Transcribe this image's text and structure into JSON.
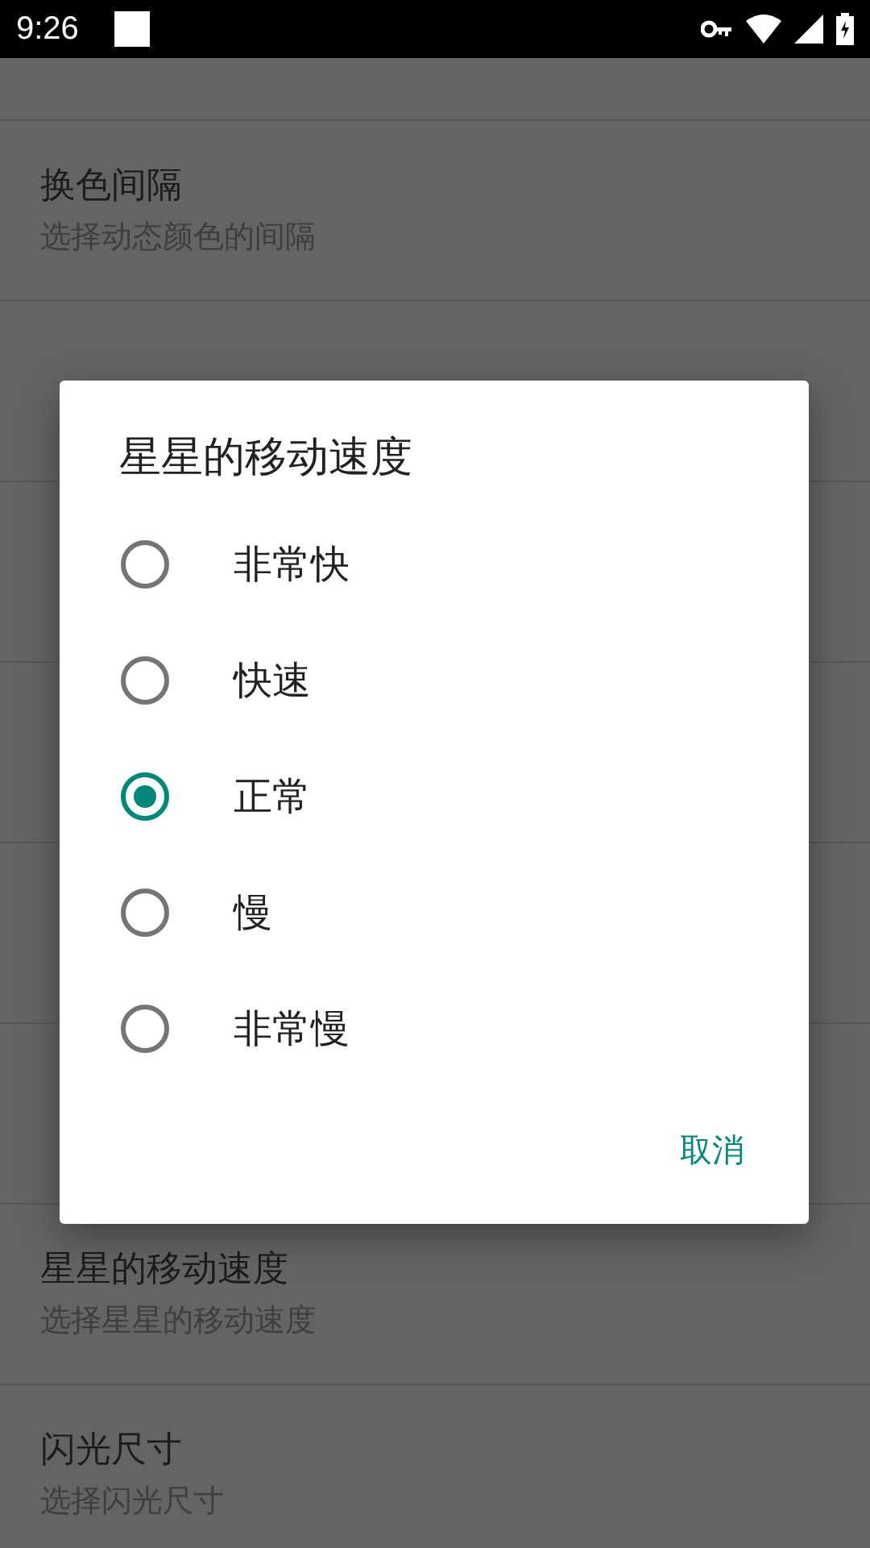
{
  "status_bar": {
    "time": "9:26"
  },
  "settings_above": [
    {
      "title": "换色间隔",
      "subtitle": "选择动态颜色的间隔"
    }
  ],
  "settings_below": [
    {
      "title": "星星的移动速度",
      "subtitle": "选择星星的移动速度"
    },
    {
      "title": "闪光尺寸",
      "subtitle": "选择闪光尺寸"
    }
  ],
  "dialog": {
    "title": "星星的移动速度",
    "options": [
      {
        "label": "非常快",
        "selected": false
      },
      {
        "label": "快速",
        "selected": false
      },
      {
        "label": "正常",
        "selected": true
      },
      {
        "label": "慢",
        "selected": false
      },
      {
        "label": "非常慢",
        "selected": false
      }
    ],
    "buttons": [
      "取消"
    ]
  }
}
